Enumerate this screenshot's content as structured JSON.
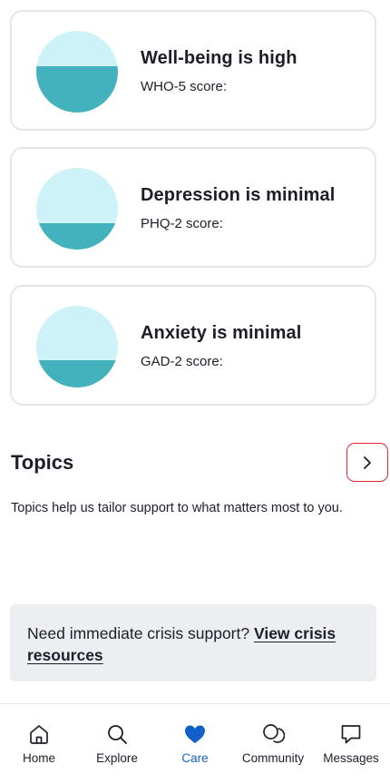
{
  "cards": [
    {
      "title": "Well-being is high",
      "score_label": "WHO-5 score:",
      "fill_percent": 57
    },
    {
      "title": "Depression is minimal",
      "score_label": "PHQ-2 score:",
      "fill_percent": 32
    },
    {
      "title": "Anxiety is minimal",
      "score_label": "GAD-2 score:",
      "fill_percent": 33
    }
  ],
  "topics": {
    "title": "Topics",
    "description": "Topics help us tailor support to what matters most to you.",
    "button_icon": "chevron-right-icon"
  },
  "crisis": {
    "text": "Need immediate crisis support?",
    "link": "View crisis resources"
  },
  "tabbar": {
    "active": "Care",
    "items": [
      {
        "label": "Home",
        "icon": "home-icon"
      },
      {
        "label": "Explore",
        "icon": "search-icon"
      },
      {
        "label": "Care",
        "icon": "heart-icon"
      },
      {
        "label": "Community",
        "icon": "community-icon"
      },
      {
        "label": "Messages",
        "icon": "chat-icon"
      }
    ]
  },
  "colors": {
    "gauge_bg": "#cdf3f8",
    "gauge_fill": "#43b2bd",
    "accent": "#1160c8",
    "highlight_border": "#e5282e"
  }
}
